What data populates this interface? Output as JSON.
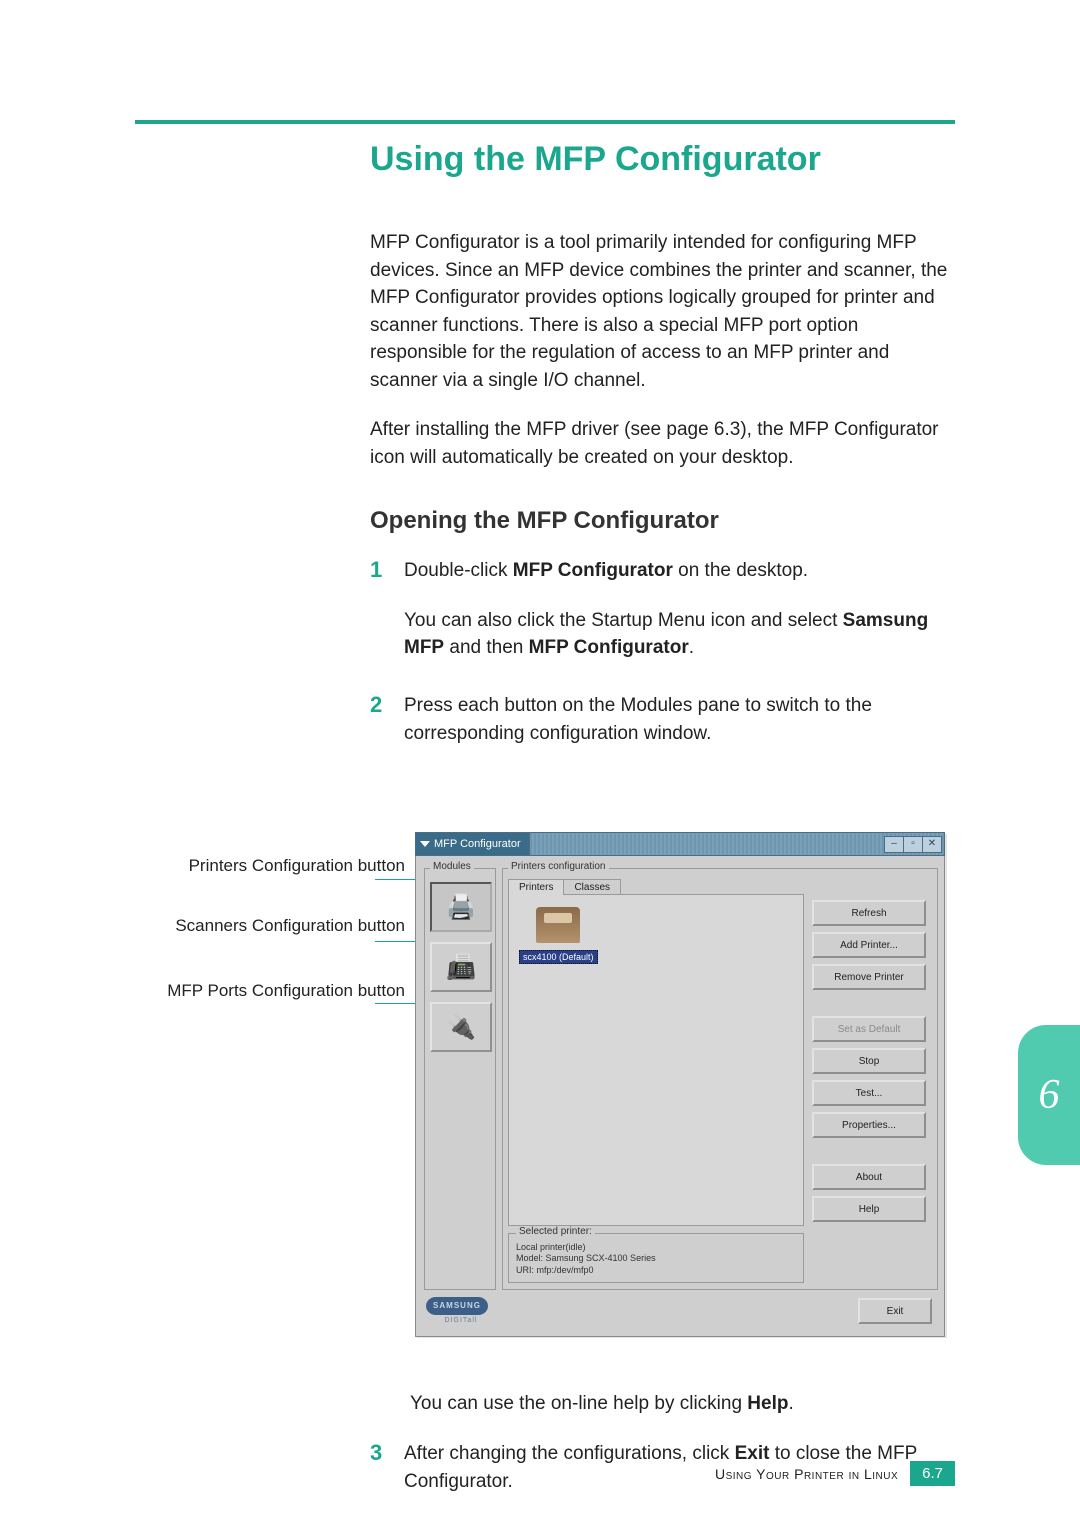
{
  "heading": "Using the MFP Configurator",
  "intro_p1": "MFP Configurator is a tool primarily intended for configuring MFP devices. Since an MFP device combines the printer and scanner, the MFP Configurator provides options logically grouped for printer and scanner functions. There is also a special MFP port option responsible for the regulation of access to an MFP printer and scanner via a single I/O channel.",
  "intro_p2": "After installing the MFP driver (see page 6.3), the MFP Configurator icon will automatically be created on your desktop.",
  "subheading": "Opening the MFP Configurator",
  "steps": {
    "s1": {
      "num": "1",
      "line1_a": "Double-click ",
      "line1_b": "MFP Configurator",
      "line1_c": " on the desktop.",
      "line2_a": "You can also click the Startup Menu icon and select ",
      "line2_b": "Samsung MFP",
      "line2_c": " and then ",
      "line2_d": "MFP Configurator",
      "line2_e": "."
    },
    "s2": {
      "num": "2",
      "line1": "Press each button on the Modules pane to switch to the corresponding configuration window.",
      "after_a": "You can use the on-line help by clicking ",
      "after_b": "Help",
      "after_c": "."
    },
    "s3": {
      "num": "3",
      "line1_a": "After changing the configurations, click ",
      "line1_b": "Exit",
      "line1_c": " to close the MFP Configurator."
    }
  },
  "callouts": {
    "c1": "Printers Configuration button",
    "c2": "Scanners Configuration button",
    "c3": "MFP Ports Configuration button"
  },
  "screenshot": {
    "title": "MFP Configurator",
    "modules_label": "Modules",
    "pconf_label": "Printers configuration",
    "tabs": {
      "t1": "Printers",
      "t2": "Classes"
    },
    "printer_name": "scx4100 (Default)",
    "buttons": {
      "refresh": "Refresh",
      "add": "Add Printer...",
      "remove": "Remove Printer",
      "setdefault": "Set as Default",
      "stop": "Stop",
      "test": "Test...",
      "properties": "Properties...",
      "about": "About",
      "help": "Help",
      "exit": "Exit"
    },
    "selected_label": "Selected printer:",
    "selected_lines": {
      "l1": "Local printer(idle)",
      "l2": "Model: Samsung SCX-4100 Series",
      "l3": "URI: mfp:/dev/mfp0"
    },
    "brand": "SAMSUNG",
    "brand_sub": "DIGITall"
  },
  "sidetab": "6",
  "footer_text": "Using Your Printer in Linux",
  "footer_page": "6.7"
}
